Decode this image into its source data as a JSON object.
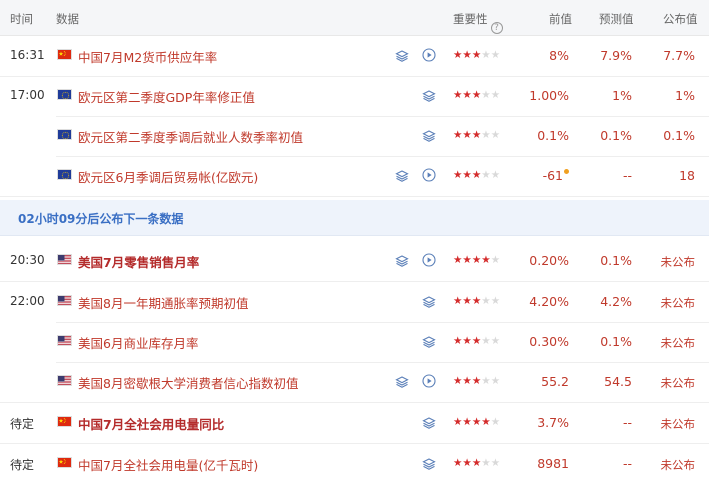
{
  "header": {
    "time": "时间",
    "data": "数据",
    "importance": "重要性",
    "help_glyph": "?",
    "previous": "前值",
    "forecast": "预测值",
    "published": "公布值"
  },
  "banner": {
    "text": "02小时09分后公布下一条数据"
  },
  "colors": {
    "accent_red": "#c0392b",
    "star_on": "#d42b2b",
    "banner_blue": "#3a6fc4",
    "dot_orange": "#f0a020"
  },
  "rows": [
    {
      "time": "16:31",
      "flag": "china-flag",
      "title": "中国7月M2货币供应年率",
      "bold": false,
      "layer": true,
      "play": true,
      "stars": 3,
      "previous": "8%",
      "forecast": "7.9%",
      "published": "7.7%"
    },
    {
      "time": "17:00",
      "flag": "eu-flag",
      "title": "欧元区第二季度GDP年率修正值",
      "bold": false,
      "layer": true,
      "play": false,
      "stars": 3,
      "previous": "1.00%",
      "forecast": "1%",
      "published": "1%"
    },
    {
      "time": "",
      "flag": "eu-flag",
      "title": "欧元区第二季度季调后就业人数季率初值",
      "bold": false,
      "layer": true,
      "play": false,
      "stars": 3,
      "previous": "0.1%",
      "forecast": "0.1%",
      "published": "0.1%"
    },
    {
      "time": "",
      "flag": "eu-flag",
      "title": "欧元区6月季调后贸易帐(亿欧元)",
      "bold": false,
      "layer": true,
      "play": true,
      "stars": 3,
      "previous": "-61",
      "forecast": "--",
      "published": "18"
    },
    {
      "time": "20:30",
      "flag": "us-flag",
      "title": "美国7月零售销售月率",
      "bold": true,
      "layer": true,
      "play": true,
      "stars": 4,
      "previous": "0.20%",
      "forecast": "0.1%",
      "published": "未公布"
    },
    {
      "time": "22:00",
      "flag": "us-flag",
      "title": "美国8月一年期通胀率预期初值",
      "bold": false,
      "layer": true,
      "play": false,
      "stars": 3,
      "previous": "4.20%",
      "forecast": "4.2%",
      "published": "未公布"
    },
    {
      "time": "",
      "flag": "us-flag",
      "title": "美国6月商业库存月率",
      "bold": false,
      "layer": true,
      "play": false,
      "stars": 3,
      "previous": "0.30%",
      "forecast": "0.1%",
      "published": "未公布"
    },
    {
      "time": "",
      "flag": "us-flag",
      "title": "美国8月密歇根大学消费者信心指数初值",
      "bold": false,
      "layer": true,
      "play": true,
      "stars": 3,
      "previous": "55.2",
      "forecast": "54.5",
      "published": "未公布"
    },
    {
      "time": "待定",
      "flag": "china-flag",
      "title": "中国7月全社会用电量同比",
      "bold": true,
      "layer": true,
      "play": false,
      "stars": 4,
      "previous": "3.7%",
      "forecast": "--",
      "published": "未公布"
    },
    {
      "time": "待定",
      "flag": "china-flag",
      "title": "中国7月全社会用电量(亿千瓦时)",
      "bold": false,
      "layer": true,
      "play": false,
      "stars": 3,
      "previous": "8981",
      "forecast": "--",
      "published": "未公布"
    }
  ]
}
